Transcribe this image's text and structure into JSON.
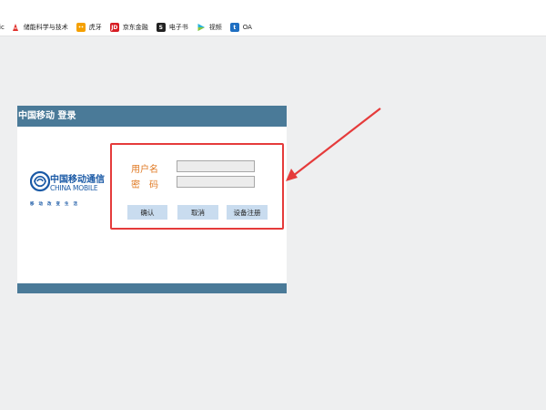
{
  "bookmarks": {
    "cut_label": "ic",
    "items": [
      {
        "label": "储能科学与技术",
        "icon": "ai-icon"
      },
      {
        "label": "虎牙",
        "icon": "huya-icon"
      },
      {
        "label": "京东金融",
        "icon": "jd-icon",
        "icon_text": "JD"
      },
      {
        "label": "电子书",
        "icon": "s-icon",
        "icon_text": "S"
      },
      {
        "label": "视频",
        "icon": "play-icon"
      },
      {
        "label": "OA",
        "icon": "oa-icon",
        "icon_text": "t"
      }
    ]
  },
  "login": {
    "title": "中国移动 登录",
    "logo": {
      "cn": "中国移动通信",
      "en": "CHINA MOBILE",
      "slogan": "移动改变生活"
    },
    "username_label": "用户名",
    "password_label": "密　码",
    "username_value": "",
    "password_value": "",
    "confirm_label": "确认",
    "cancel_label": "取消",
    "register_label": "设备注册"
  },
  "colors": {
    "header": "#4a7a98",
    "label": "#e07a24",
    "highlight": "#e53b3b",
    "button": "#c9dcef"
  }
}
